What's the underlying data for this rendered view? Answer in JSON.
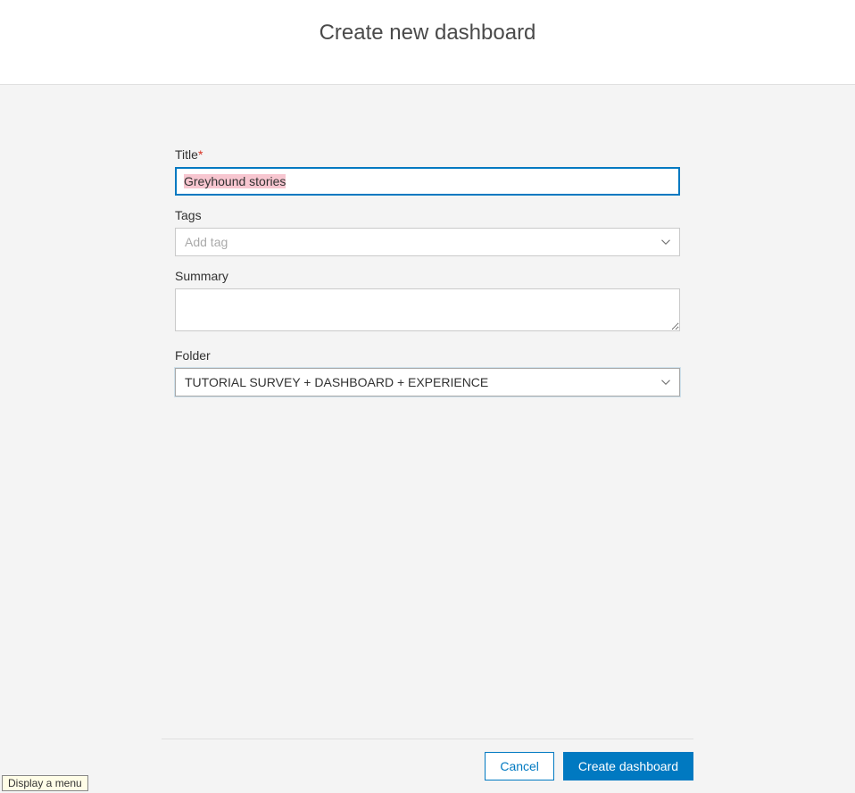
{
  "header": {
    "title": "Create new dashboard"
  },
  "form": {
    "title": {
      "label": "Title",
      "required_marker": "*",
      "value": "Greyhound stories"
    },
    "tags": {
      "label": "Tags",
      "placeholder": "Add tag"
    },
    "summary": {
      "label": "Summary",
      "value": ""
    },
    "folder": {
      "label": "Folder",
      "selected": "TUTORIAL SURVEY + DASHBOARD + EXPERIENCE"
    }
  },
  "buttons": {
    "cancel": "Cancel",
    "create": "Create dashboard"
  },
  "tooltip": "Display a menu"
}
